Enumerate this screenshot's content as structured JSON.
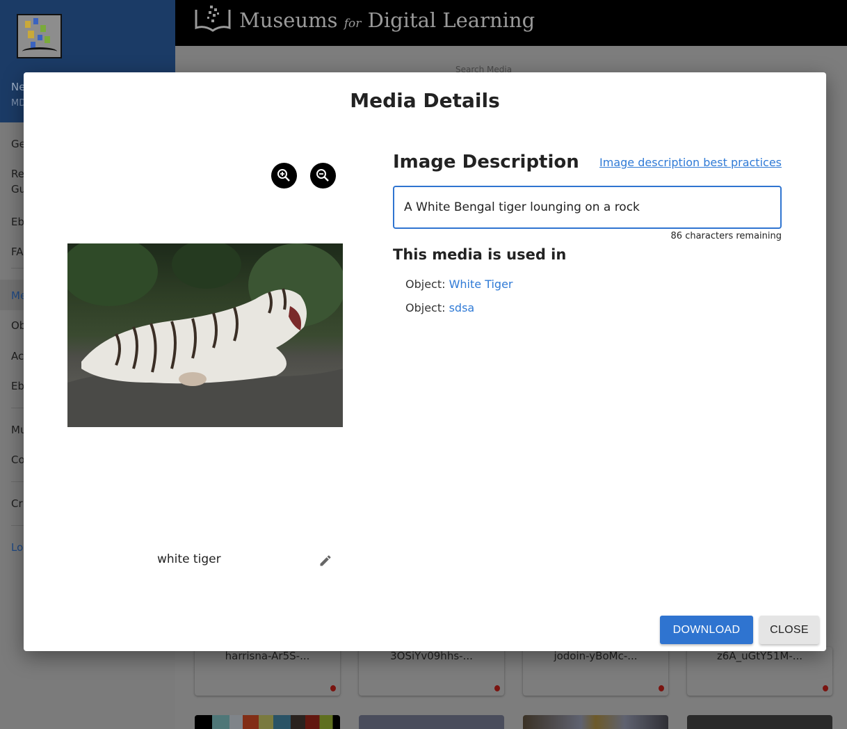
{
  "header": {
    "brand_main": "Museums",
    "brand_for": "for",
    "brand_rest": "Digital Learning"
  },
  "sidebar": {
    "items": [
      {
        "label": "Ne"
      },
      {
        "label": "MD"
      },
      {
        "label": "Ge"
      },
      {
        "label": "Re\nGu"
      },
      {
        "label": "Eb"
      },
      {
        "label": "FA"
      },
      {
        "label": "Me"
      },
      {
        "label": "Ob"
      },
      {
        "label": "Ac"
      },
      {
        "label": "Eb"
      },
      {
        "label": "Mu"
      },
      {
        "label": "Co"
      },
      {
        "label": "Cr"
      },
      {
        "label": "Lo"
      }
    ]
  },
  "search": {
    "label": "Search Media"
  },
  "cards": [
    "harrisna-Ar5S-...",
    "3OSiYv09hhs-...",
    "jodoin-yBoMc-...",
    "z6A_uGtY51M-..."
  ],
  "modal": {
    "title": "Media Details",
    "zoom_in_icon": "zoom-in-icon",
    "zoom_out_icon": "zoom-out-icon",
    "caption": "white tiger",
    "edit_icon": "pencil-icon",
    "description_heading": "Image Description",
    "best_practices_link": "Image description best practices",
    "description_value": "A White Bengal tiger lounging on a rock",
    "characters_remaining": "86 characters remaining",
    "used_in_heading": "This media is used in",
    "used_in": [
      {
        "prefix": "Object:",
        "name": "White Tiger"
      },
      {
        "prefix": "Object:",
        "name": "sdsa"
      }
    ],
    "download_label": "DOWNLOAD",
    "close_label": "CLOSE"
  },
  "colors": {
    "accent": "#2f74d0",
    "link": "#2f7ad6",
    "header": "#000000",
    "sidebar": "#1b3b66"
  }
}
